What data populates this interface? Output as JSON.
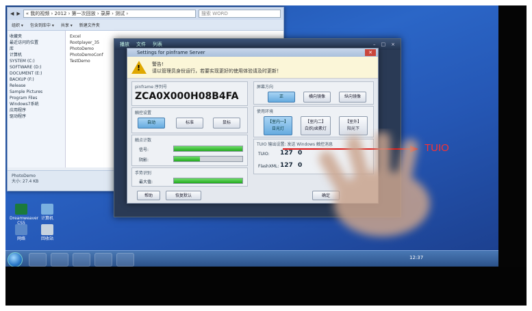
{
  "explorer": {
    "address": "« 我的视频 › 2012 › 第一次回放 › 录屏 › 测试 ›",
    "search_placeholder": "搜索 WORD",
    "toolbar": [
      "组织 ▾",
      "包含到库中 ▾",
      "共享 ▾",
      "新建文件夹"
    ],
    "nav_items": [
      "收藏夹",
      "最近访问的位置",
      "库",
      "计算机",
      "SYSTEM (C:)",
      "SOFTWARE (D:)",
      "DOCUMENT (E:)",
      "BACKUP (F:)",
      "Release",
      "Sample Pictures",
      "Program Files",
      "Windows7系统",
      "应用程序",
      "驱动程序"
    ],
    "files": [
      "Excel",
      "Rootplayer_35",
      "PhotoDemo",
      "PhotoDemoConf",
      "TestDemo"
    ],
    "status_name": "PhotoDemo",
    "status_size": "大小: 27.4 KB"
  },
  "player": {
    "tabs": [
      "播放",
      "文件",
      "列表"
    ],
    "window_controls": [
      "–",
      "□",
      "×"
    ]
  },
  "dialog": {
    "title": "Settings for pinframe Server",
    "warning_title": "警告!",
    "warning_text": "请以管理员身份运行，若要实现更好的使用体验请及时更新！",
    "serial_label": "pinframe 序列号",
    "serial": "ZCA0X000H08B4FA",
    "mode_label": "触控设置",
    "mode_buttons": [
      "自动",
      "标准",
      "鼠标"
    ],
    "sensor_label": "触点计数",
    "sensor_rows": [
      {
        "label": "信号:",
        "level": 1.0
      },
      {
        "label": "阴影:",
        "level": 0.38
      }
    ],
    "touch_label": "手势识别",
    "touch_rows": [
      {
        "label": "最大值:",
        "level": 1.0
      }
    ],
    "orientation_label": "屏幕方向",
    "orientation_buttons": [
      "正",
      "横向镜像",
      "纵向镜像"
    ],
    "use_label": "使用环境",
    "use_buttons": [
      "【室内一】\n日光灯",
      "【室内二】\n白炽/卤素灯",
      "【室外】\n阳光下"
    ],
    "tuio_label": "TUIO 输出设置: 发送 Windows 触控消息",
    "ip_rows": [
      {
        "label": "TUIO:",
        "values": [
          "127",
          "0"
        ]
      },
      {
        "label": "FlashXML:",
        "values": [
          "127",
          "0"
        ]
      }
    ],
    "bottom_buttons": [
      "帮助",
      "恢复默认"
    ],
    "ok_button": "确定"
  },
  "annotation": {
    "label": "TUIO",
    "color": "#e01010"
  },
  "desktop_icons": [
    {
      "label": "Dreamweaver CS5"
    },
    {
      "label": "计算机"
    },
    {
      "label": "网络"
    },
    {
      "label": "回收站"
    }
  ],
  "taskbar": {
    "clock": "12:37"
  }
}
